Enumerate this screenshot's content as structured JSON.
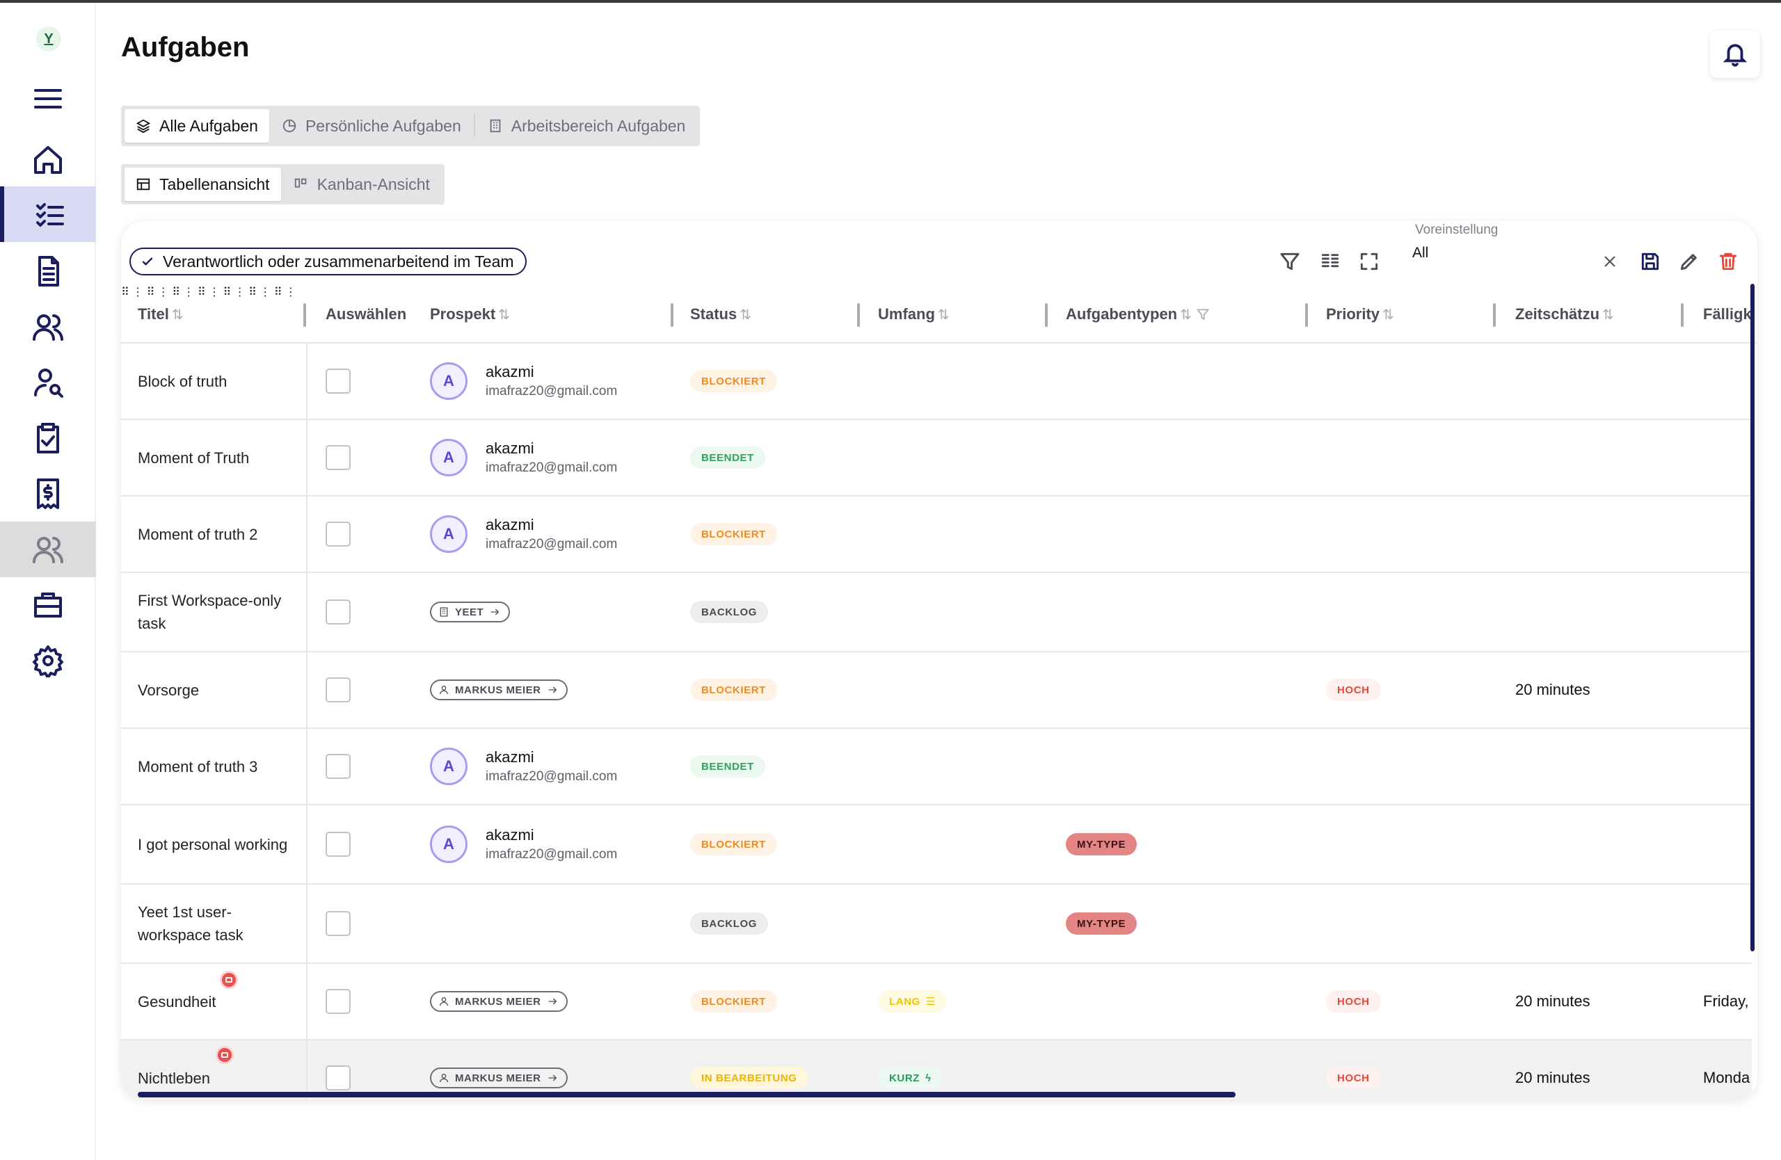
{
  "app": {
    "logo_letter": "Y",
    "page_title": "Aufgaben"
  },
  "sidebar": {
    "items": [
      {
        "name": "menu",
        "icon": "menu-icon"
      },
      {
        "name": "home",
        "icon": "home-icon"
      },
      {
        "name": "tasks",
        "icon": "task-list-icon",
        "active": true
      },
      {
        "name": "documents",
        "icon": "document-icon"
      },
      {
        "name": "contacts",
        "icon": "users-icon"
      },
      {
        "name": "user-search",
        "icon": "user-search-icon"
      },
      {
        "name": "clipboard",
        "icon": "clipboard-check-icon"
      },
      {
        "name": "invoices",
        "icon": "receipt-dollar-icon"
      },
      {
        "name": "team",
        "icon": "users-icon",
        "hover": true
      },
      {
        "name": "workspace",
        "icon": "briefcase-icon"
      },
      {
        "name": "settings",
        "icon": "gear-icon"
      }
    ]
  },
  "scope_tabs": {
    "all": "Alle Aufgaben",
    "personal": "Persönliche Aufgaben",
    "workspace": "Arbeitsbereich Aufgaben",
    "selected": "Alle Aufgaben"
  },
  "view_tabs": {
    "table": "Tabellenansicht",
    "kanban": "Kanban-Ansicht",
    "selected": "Tabellenansicht"
  },
  "toolbar": {
    "filter_chip": "Verantwortlich oder zusammenarbeitend im Team",
    "preset_label": "Voreinstellung",
    "preset_value": "All"
  },
  "columns": {
    "title": "Titel",
    "select": "Auswählen",
    "prospect": "Prospekt",
    "status": "Status",
    "scope": "Umfang",
    "task_types": "Aufgabentypen",
    "priority": "Priority",
    "estimate": "Zeitschätzu",
    "due": "Fälligk"
  },
  "rows": [
    {
      "title": "Block of truth",
      "prospect_name": "akazmi",
      "prospect_email": "imafraz20@gmail.com",
      "avatar": "A",
      "status": "BLOCKIERT"
    },
    {
      "title": "Moment of Truth",
      "prospect_name": "akazmi",
      "prospect_email": "imafraz20@gmail.com",
      "avatar": "A",
      "status": "BEENDET"
    },
    {
      "title": "Moment of truth 2",
      "prospect_name": "akazmi",
      "prospect_email": "imafraz20@gmail.com",
      "avatar": "A",
      "status": "BLOCKIERT"
    },
    {
      "title": "First Workspace-only task",
      "prospect_chip": "YEET",
      "status": "BACKLOG"
    },
    {
      "title": "Vorsorge",
      "prospect_chip": "MARKUS MEIER",
      "status": "BLOCKIERT",
      "priority": "HOCH",
      "estimate": "20 minutes"
    },
    {
      "title": "Moment of truth 3",
      "prospect_name": "akazmi",
      "prospect_email": "imafraz20@gmail.com",
      "avatar": "A",
      "status": "BEENDET"
    },
    {
      "title": "I got personal working",
      "prospect_name": "akazmi",
      "prospect_email": "imafraz20@gmail.com",
      "avatar": "A",
      "status": "BLOCKIERT",
      "task_type": "MY-TYPE"
    },
    {
      "title": "Yeet 1st user-workspace task",
      "status": "BACKLOG",
      "task_type": "MY-TYPE"
    },
    {
      "title": "Gesundheit",
      "prospect_chip": "MARKUS MEIER",
      "status": "BLOCKIERT",
      "scope": "LANG",
      "priority": "HOCH",
      "estimate": "20 minutes",
      "due": "Friday,"
    },
    {
      "title": "Nichtleben",
      "prospect_chip": "MARKUS MEIER",
      "status": "IN BEARBEITUNG",
      "scope": "KURZ",
      "priority": "HOCH",
      "estimate": "20 minutes",
      "due": "Monda"
    }
  ],
  "colors": {
    "brand": "#1b1e5e",
    "status_blockiert": "#f08a1e",
    "status_beendet": "#2fa25c",
    "priority_hoch": "#e5483c",
    "type_my": "#e48585",
    "delete": "#e5483c"
  }
}
